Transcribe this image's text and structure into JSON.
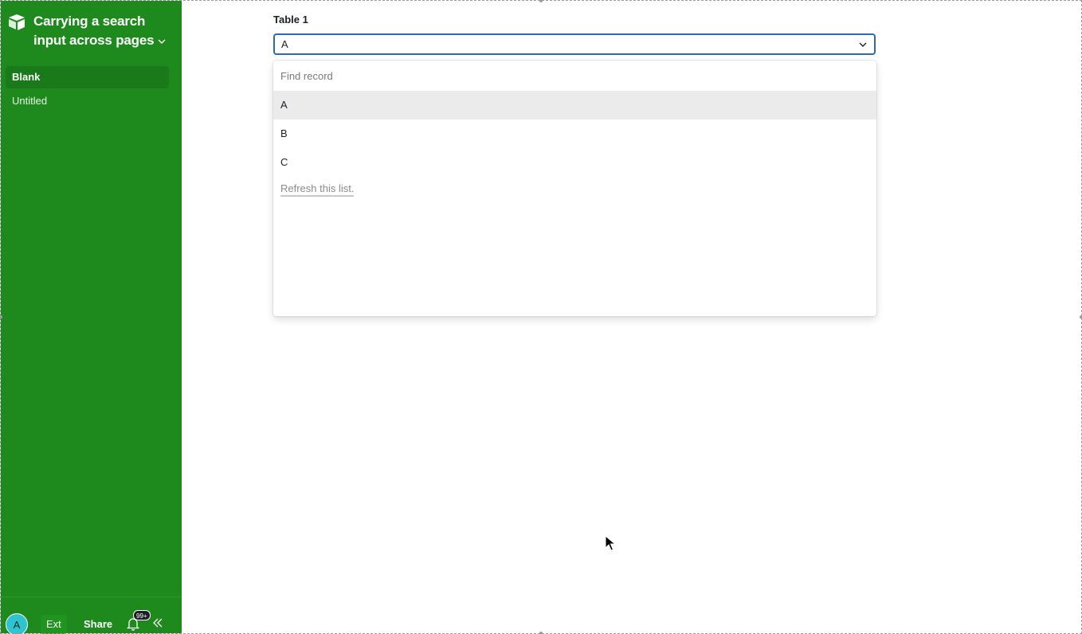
{
  "app": {
    "title": "Carrying a search input across pages",
    "brand_color": "#1e8a1e"
  },
  "sidebar": {
    "items": [
      {
        "label": "Blank",
        "active": true
      },
      {
        "label": "Untitled",
        "active": false
      }
    ],
    "footer": {
      "avatar_initial": "A",
      "ext_label": "Ext",
      "share_label": "Share",
      "notification_badge": "99+"
    }
  },
  "main": {
    "field_label": "Table 1",
    "selected_value": "A",
    "dropdown": {
      "search_placeholder": "Find record",
      "options": [
        "A",
        "B",
        "C"
      ],
      "selected_index": 0,
      "refresh_label": "Refresh this list."
    }
  },
  "icons": {
    "logo": "airtable-logo-icon",
    "title_chevron": "chevron-down-icon",
    "select_chevron": "chevron-down-icon",
    "bell": "bell-icon",
    "collapse": "double-chevron-left-icon",
    "cursor": "mouse-pointer-icon"
  }
}
